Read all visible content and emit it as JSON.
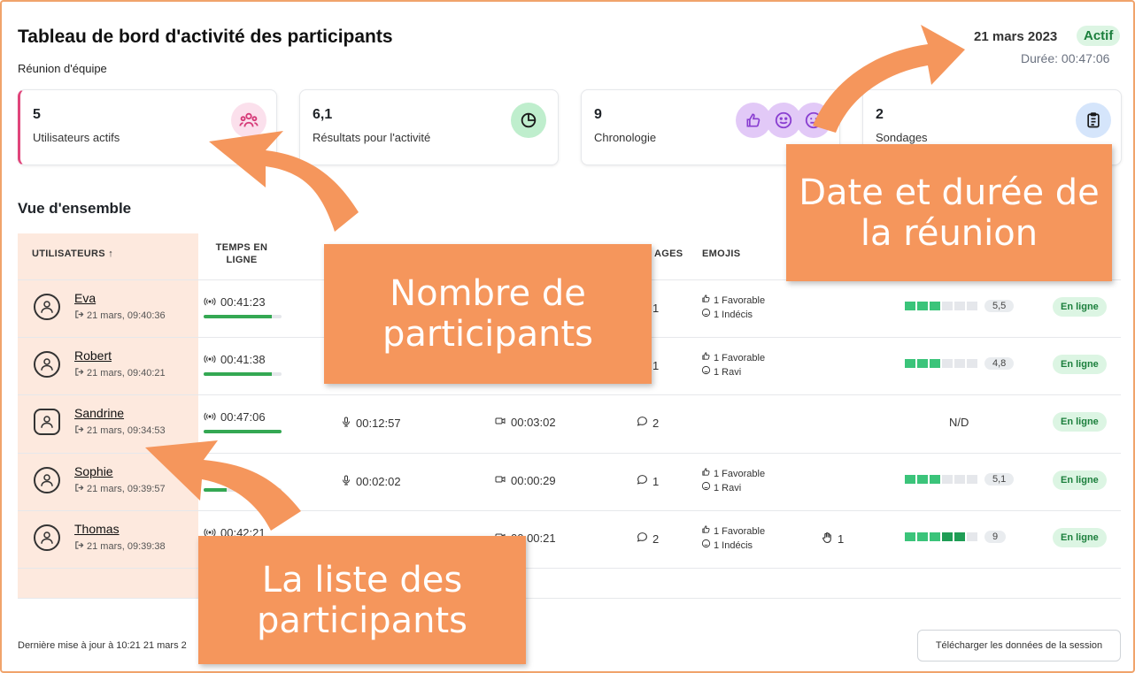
{
  "header": {
    "title": "Tableau de bord d'activité des participants",
    "subtitle": "Réunion d'équipe",
    "date": "21 mars 2023",
    "status": "Actif",
    "duration": "Durée: 00:47:06"
  },
  "cards": [
    {
      "value": "5",
      "label": "Utilisateurs actifs",
      "icon": "users-icon"
    },
    {
      "value": "6,1",
      "label": "Résultats pour l'activité",
      "icon": "pie-chart-icon"
    },
    {
      "value": "9",
      "label": "Chronologie",
      "icon": "reactions-icon"
    },
    {
      "value": "2",
      "label": "Sondages",
      "icon": "clipboard-icon"
    }
  ],
  "overview": {
    "title": "Vue d'ensemble",
    "headers": {
      "users": "UTILISATEURS ↑",
      "online_1": "TEMPS EN",
      "online_2": "LIGNE",
      "messages": "AGES",
      "emojis": "EMOJIS"
    },
    "rows": [
      {
        "name": "Eva",
        "joined": "21 mars, 09:40:36",
        "online": "00:41:23",
        "online_fraction": 0.88,
        "talk": "",
        "webcam": "",
        "messages": "1",
        "emoji_1": "1 Favorable",
        "emoji_2": "1 Indécis",
        "raised": "",
        "score": "5,5",
        "segments": 3,
        "status": "En ligne"
      },
      {
        "name": "Robert",
        "joined": "21 mars, 09:40:21",
        "online": "00:41:38",
        "online_fraction": 0.88,
        "talk": "",
        "webcam": "",
        "messages": "1",
        "emoji_1": "1 Favorable",
        "emoji_2": "1 Ravi",
        "raised": "",
        "score": "4,8",
        "segments": 3,
        "status": "En ligne"
      },
      {
        "name": "Sandrine",
        "joined": "21 mars, 09:34:53",
        "online": "00:47:06",
        "online_fraction": 1.0,
        "talk": "00:12:57",
        "webcam": "00:03:02",
        "messages": "2",
        "emoji_1": "",
        "emoji_2": "",
        "raised": "",
        "score": "N/D",
        "segments": 0,
        "status": "En ligne"
      },
      {
        "name": "Sophie",
        "joined": "21 mars, 09:39:57",
        "online": "",
        "online_fraction": 0.3,
        "talk": "00:02:02",
        "webcam": "00:00:29",
        "messages": "1",
        "emoji_1": "1 Favorable",
        "emoji_2": "1 Ravi",
        "raised": "",
        "score": "5,1",
        "segments": 3,
        "status": "En ligne"
      },
      {
        "name": "Thomas",
        "joined": "21 mars, 09:39:38",
        "online": "00:42:21",
        "online_fraction": 0.9,
        "talk": "",
        "webcam": "00:00:21",
        "messages": "2",
        "emoji_1": "1 Favorable",
        "emoji_2": "1 Indécis",
        "raised": "1",
        "score": "9",
        "segments": 5,
        "status": "En ligne"
      }
    ]
  },
  "footer": {
    "last_update": "Dernière mise à jour à 10:21 21 mars 2",
    "download": "Télécharger les données de la session"
  },
  "callouts": {
    "date": "Date et durée de la réunion",
    "participants": "Nombre de participants",
    "list": "La liste des participants"
  },
  "colors": {
    "accent_pink": "#e0457b",
    "callout_orange": "#f5965c",
    "online_green": "#34a853",
    "status_green": "#1b7f3c"
  }
}
